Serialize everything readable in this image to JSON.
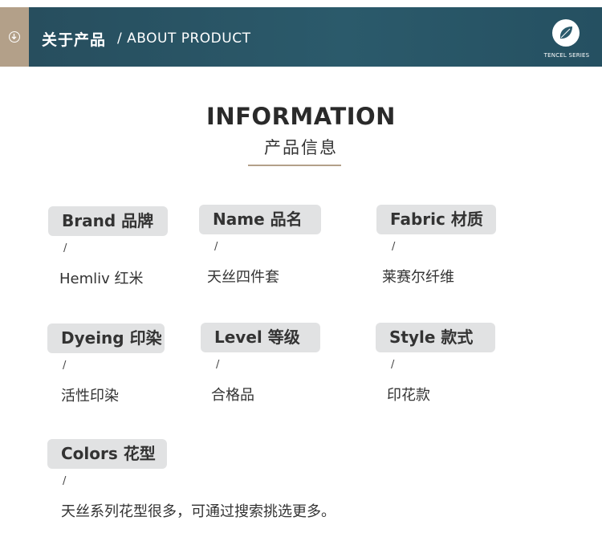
{
  "header": {
    "title": "关于产品",
    "subtitle": "/ ABOUT PRODUCT",
    "logo_text": "TENCEL SERIES",
    "colors": {
      "bar": "#2b5a6b",
      "tab": "#b3a089"
    }
  },
  "section": {
    "title_en": "INFORMATION",
    "title_cn": "产品信息"
  },
  "separator": "/",
  "items": [
    {
      "label": "Brand 品牌",
      "value": "Hemliv 红米"
    },
    {
      "label": "Name  品名",
      "value": "天丝四件套"
    },
    {
      "label": "Fabric 材质",
      "value": "莱赛尔纤维"
    },
    {
      "label": "Dyeing 印染",
      "value": "活性印染"
    },
    {
      "label": "Level  等级",
      "value": "合格品"
    },
    {
      "label": "Style 款式",
      "value": "印花款"
    },
    {
      "label": "Colors 花型",
      "value": "天丝系列花型很多，可通过搜索挑选更多。"
    }
  ]
}
